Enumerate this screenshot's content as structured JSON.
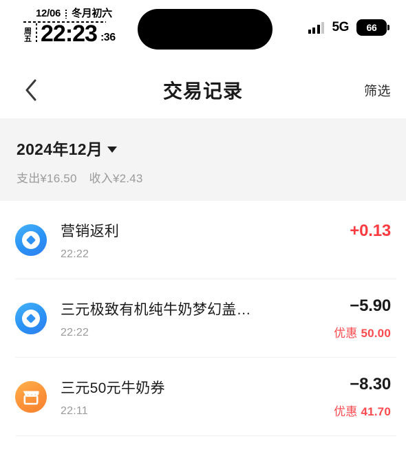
{
  "status_bar": {
    "date": "12/06",
    "lunar_date": "冬月初六",
    "weekday": "周五",
    "time": "22:23",
    "seconds": ":36",
    "network": "5G",
    "battery_level": "66",
    "signal_icon": "signal-bars-icon",
    "dynamic_island": "dynamic-island"
  },
  "header": {
    "back_icon": "chevron-left-icon",
    "title": "交易记录",
    "filter_label": "筛选"
  },
  "summary": {
    "month_label": "2024年12月",
    "caret_icon": "chevron-down-icon",
    "expense_label": "支出¥16.50",
    "income_label": "收入¥2.43"
  },
  "transactions": [
    {
      "icon": "alipay-icon",
      "title": "营销返利",
      "time": "22:22",
      "amount": "+0.13",
      "amount_type": "income",
      "discount_label": "",
      "discount_value": ""
    },
    {
      "icon": "alipay-icon",
      "title": "三元极致有机纯牛奶梦幻盖…",
      "time": "22:22",
      "amount": "−5.90",
      "amount_type": "expense",
      "discount_label": "优惠",
      "discount_value": "50.00"
    },
    {
      "icon": "shop-icon",
      "title": "三元50元牛奶券",
      "time": "22:11",
      "amount": "−8.30",
      "amount_type": "expense",
      "discount_label": "优惠",
      "discount_value": "41.70"
    }
  ],
  "colors": {
    "income_red": "#fb3b40",
    "discount_red": "#fb4a4e",
    "alipay_blue": "#2e93f4",
    "shop_orange": "#fb9238",
    "summary_bg": "#f4f4f4",
    "text_primary": "#1a1a1a",
    "text_muted": "#9a9a9a"
  }
}
